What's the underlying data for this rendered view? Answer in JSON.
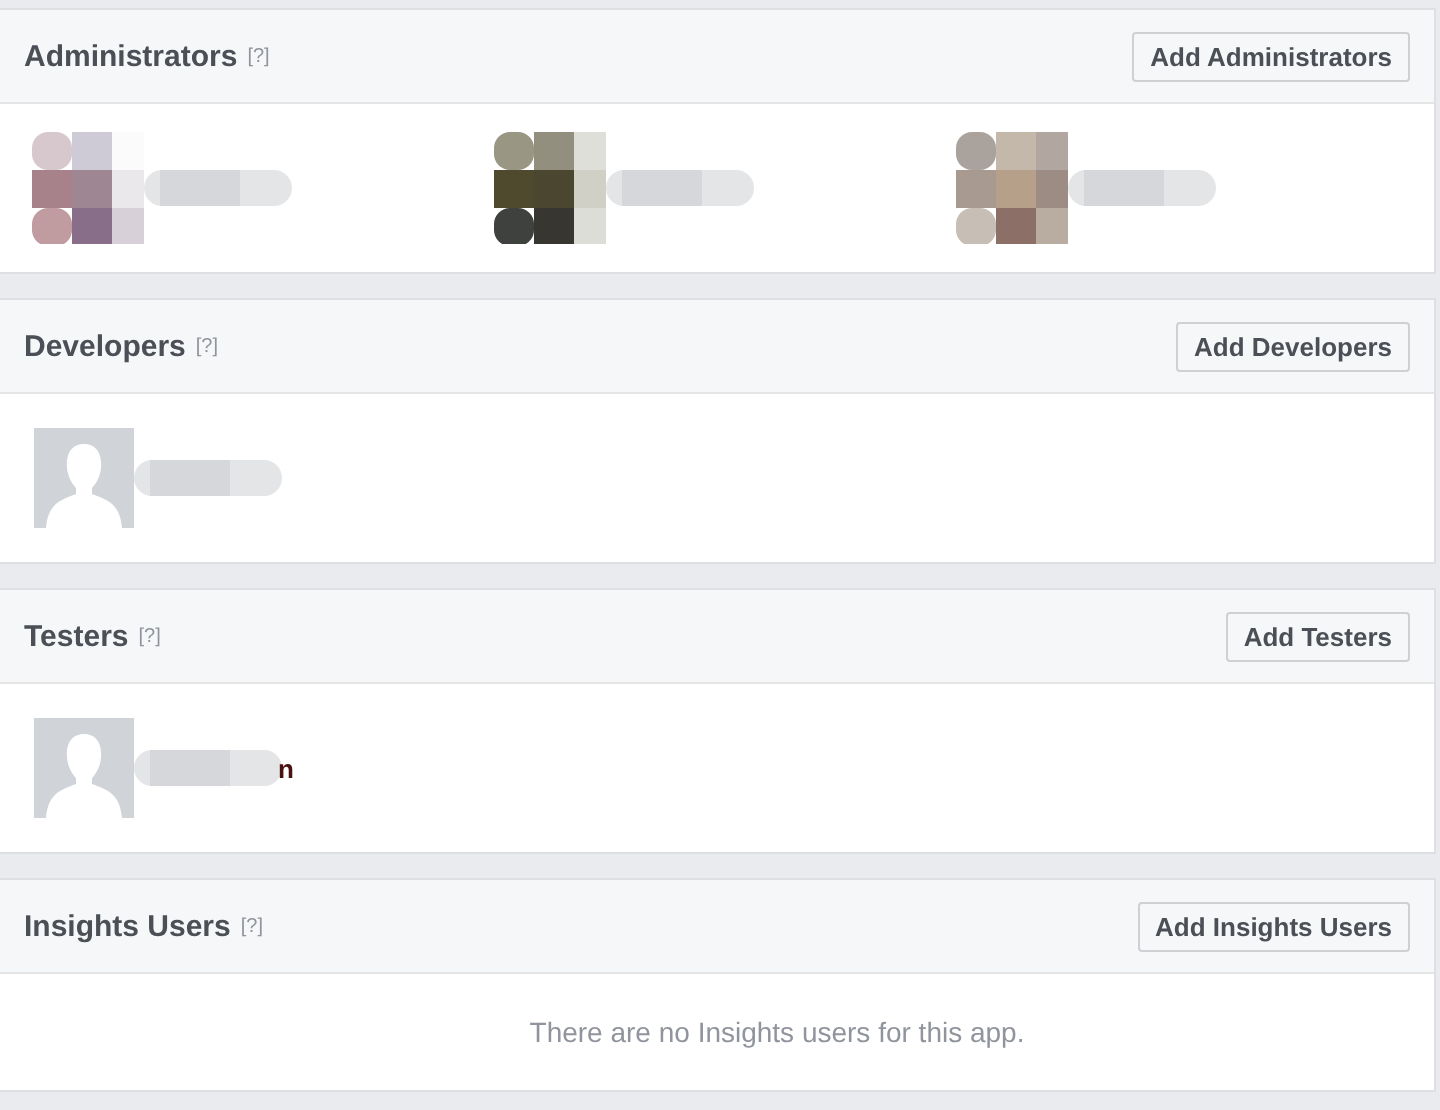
{
  "sections": [
    {
      "title": "Administrators",
      "help": "[?]",
      "button": "Add Administrators"
    },
    {
      "title": "Developers",
      "help": "[?]",
      "button": "Add Developers",
      "members": [
        {
          "kind": "silhouette"
        }
      ]
    },
    {
      "title": "Testers",
      "help": "[?]",
      "button": "Add Testers",
      "members": [
        {
          "kind": "silhouette",
          "name_tail": "n"
        }
      ]
    },
    {
      "title": "Insights Users",
      "help": "[?]",
      "button": "Add Insights Users",
      "empty_message": "There are no Insights users for this app."
    }
  ]
}
